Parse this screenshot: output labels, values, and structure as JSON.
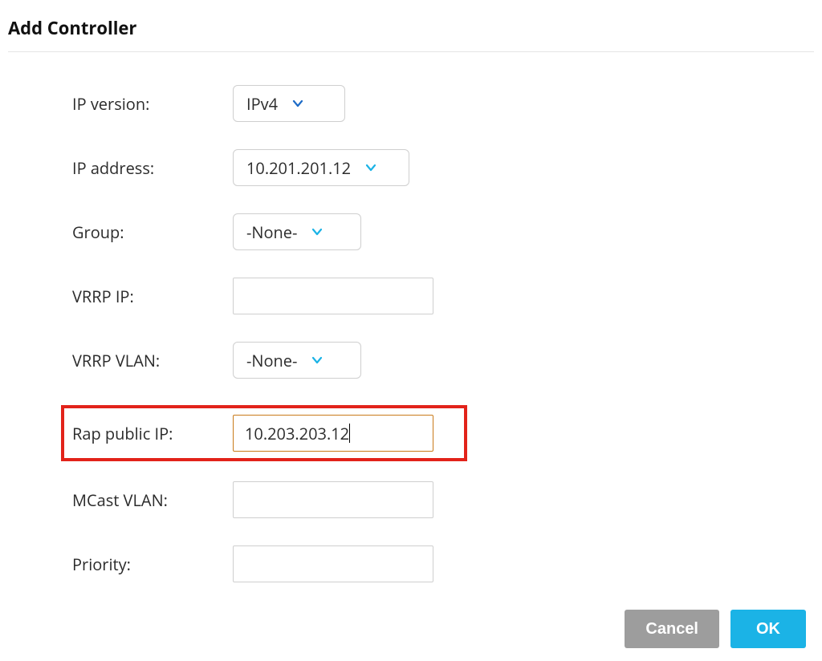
{
  "header": {
    "title": "Add Controller"
  },
  "fields": {
    "ip_version": {
      "label": "IP version:",
      "value": "IPv4"
    },
    "ip_address": {
      "label": "IP address:",
      "value": "10.201.201.12"
    },
    "group": {
      "label": "Group:",
      "value": "-None-"
    },
    "vrrp_ip": {
      "label": "VRRP IP:",
      "value": ""
    },
    "vrrp_vlan": {
      "label": "VRRP VLAN:",
      "value": "-None-"
    },
    "rap_public_ip": {
      "label": "Rap public IP:",
      "value": "10.203.203.12"
    },
    "mcast_vlan": {
      "label": "MCast VLAN:",
      "value": ""
    },
    "priority": {
      "label": "Priority:",
      "value": ""
    }
  },
  "buttons": {
    "cancel": "Cancel",
    "ok": "OK"
  },
  "colors": {
    "highlight_border": "#e2231a",
    "focus_border": "#c97b1a",
    "primary": "#1bb3e6",
    "cancel": "#9d9d9d"
  }
}
